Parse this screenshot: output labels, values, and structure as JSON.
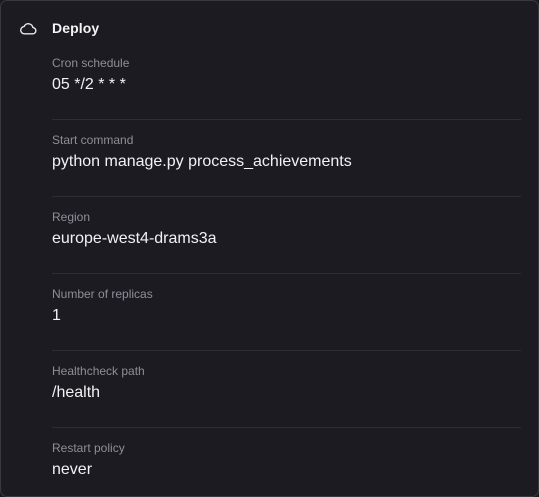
{
  "section": {
    "title": "Deploy",
    "icon": "cloud-icon"
  },
  "fields": [
    {
      "label": "Cron schedule",
      "value": "05 */2 * * *"
    },
    {
      "label": "Start command",
      "value": "python manage.py process_achievements"
    },
    {
      "label": "Region",
      "value": "europe-west4-drams3a"
    },
    {
      "label": "Number of replicas",
      "value": "1"
    },
    {
      "label": "Healthcheck path",
      "value": "/health"
    },
    {
      "label": "Restart policy",
      "value": "never"
    }
  ],
  "colors": {
    "background": "#1c1b22",
    "border": "#3a3942",
    "label": "#8f8e98",
    "value": "#f2f2f4"
  }
}
